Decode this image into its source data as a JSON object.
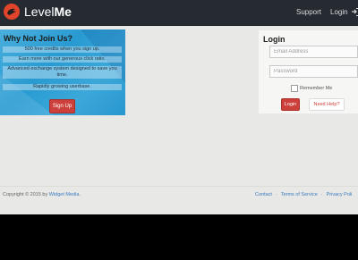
{
  "nav": {
    "brand_part1": "Level",
    "brand_part2": "Me",
    "support": "Support",
    "login": "Login",
    "logo_icon": "dragon-logo-icon",
    "signin_icon": "sign-in-icon"
  },
  "promo": {
    "title": "Why Not Join Us?",
    "items": [
      "500 free credits when you sign up.",
      "Earn more with our generous click ratio.",
      "Advanced exchange system designed to save you time.",
      "Rapidly growing userbase."
    ],
    "signup": "Sign Up"
  },
  "login": {
    "title": "Login",
    "email_placeholder": "Email Address",
    "password_placeholder": "Password",
    "remember": "Remember Me",
    "button": "Login",
    "help": "Need Help?"
  },
  "footer": {
    "copyright_prefix": "Copyright © 2015 by",
    "brand": "Widget Media.",
    "links": [
      "Contact",
      "Terms of Service",
      "Privacy Poli"
    ]
  },
  "colors": {
    "navbar": "#262b32",
    "accent": "#cc3f3a",
    "promo": "#2c9fd3",
    "link": "#3a7bc0"
  }
}
